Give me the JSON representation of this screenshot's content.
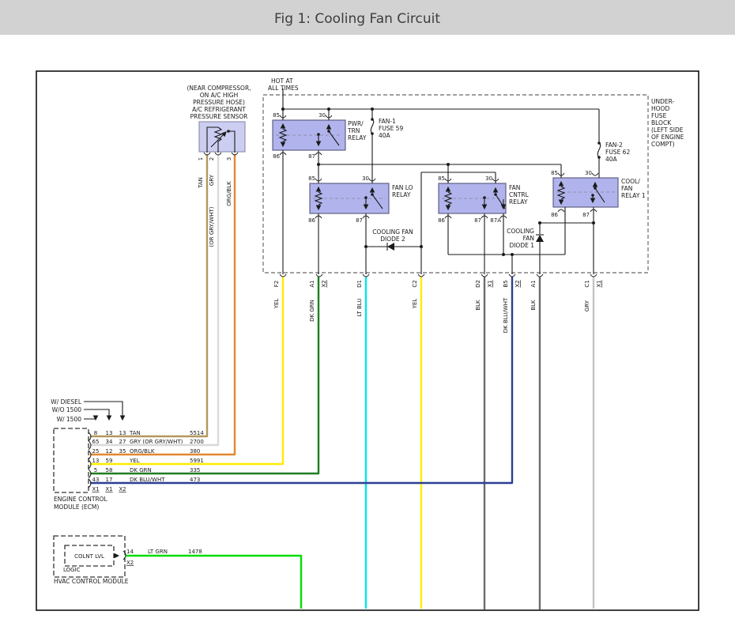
{
  "title": "Fig 1: Cooling Fan Circuit",
  "colors": {
    "header_bg": "#d2d2d2",
    "block_fill": "#cbcdf1",
    "relay_fill": "#b1b4ec",
    "label_blue": "#5e6fd6",
    "link_blue": "#3f62d9",
    "navy": "#223a8c",
    "yel": "#ffeb00",
    "dk_grn": "#1e7d22",
    "lt_blu": "#00e5ee",
    "blk": "#6b6b6b",
    "dk_blu_wht": "#2b3f94",
    "gry": "#c4c4c4",
    "tan": "#b3985e",
    "gry_wht": "#d9d9d9",
    "org_blk": "#e2882f",
    "lt_grn": "#00dd00"
  },
  "power": [
    "HOT AT",
    "ALL TIMES"
  ],
  "sensor": {
    "location": [
      "(NEAR COMPRESSOR,",
      "ON A/C HIGH",
      "PRESSURE HOSE)"
    ],
    "name": [
      "A/C REFRIGERANT",
      "PRESSURE SENSOR"
    ],
    "pins": [
      "1",
      "2",
      "3"
    ],
    "wires": [
      "TAN",
      "GRY",
      "(OR GRY/WHT)",
      "ORG/BLK"
    ]
  },
  "fuse_block": {
    "name": [
      "UNDER-",
      "HOOD",
      "FUSE",
      "BLOCK",
      "(LEFT SIDE",
      "OF ENGINE",
      "COMPT)"
    ],
    "fuse1": [
      "FAN-1",
      "FUSE 59",
      "40A"
    ],
    "fuse2": [
      "FAN-2",
      "FUSE 62",
      "40A"
    ],
    "relay_pwr": {
      "name": [
        "PWR/",
        "TRN",
        "RELAY"
      ],
      "p": [
        "85",
        "30",
        "86",
        "87"
      ]
    },
    "relay_fanlo": {
      "name": [
        "FAN LO",
        "RELAY"
      ],
      "p": [
        "85",
        "30",
        "86",
        "87"
      ]
    },
    "relay_fancntrl": {
      "name": [
        "FAN",
        "CNTRL",
        "RELAY"
      ],
      "p": [
        "85",
        "30",
        "86",
        "87",
        "87A"
      ]
    },
    "relay_coolfan": {
      "name": [
        "COOL/",
        "FAN",
        "RELAY 1"
      ],
      "p": [
        "85",
        "30",
        "86",
        "87"
      ]
    },
    "diode2": [
      "COOLING FAN",
      "DIODE 2"
    ],
    "diode1": [
      "COOLING",
      "FAN",
      "DIODE 1"
    ],
    "exits": [
      {
        "pin": "F2",
        "conn": ""
      },
      {
        "pin": "A1",
        "conn": "X2"
      },
      {
        "pin": "D1",
        "conn": ""
      },
      {
        "pin": "C2",
        "conn": ""
      },
      {
        "pin": "D2",
        "conn": "X1"
      },
      {
        "pin": "B5",
        "conn": "X2"
      },
      {
        "pin": "A1",
        "conn": ""
      },
      {
        "pin": "C1",
        "conn": "X1"
      }
    ]
  },
  "wire_labels": [
    "YEL",
    "DK GRN",
    "LT BLU",
    "YEL",
    "BLK",
    "DK BLU/WHT",
    "BLK",
    "GRY"
  ],
  "ecm": {
    "variants": [
      "W/ DIESEL",
      "W/O 1500",
      "W/ 1500"
    ],
    "rows": [
      [
        "8",
        "13",
        "13",
        "TAN",
        "5514"
      ],
      [
        "65",
        "34",
        "27",
        "GRY  (OR GRY/WHT)",
        "2700"
      ],
      [
        "25",
        "12",
        "35",
        "ORG/BLK",
        "380"
      ],
      [
        "13",
        "59",
        "",
        "YEL",
        "5991"
      ],
      [
        "5",
        "58",
        "",
        "DK GRN",
        "335"
      ],
      [
        "43",
        "17",
        "",
        "DK BLU/WHT",
        "473"
      ]
    ],
    "conns": [
      "X1",
      "X1",
      "X2"
    ],
    "name": [
      "ENGINE CONTROL",
      "MODULE (ECM)"
    ]
  },
  "hvac": {
    "logic_block": "COLNT LVL",
    "logic": "LOGIC",
    "name": "HVAC CONTROL MODULE",
    "pin": "14",
    "conn": "X2",
    "wire": "LT GRN",
    "circuit": "1478"
  }
}
